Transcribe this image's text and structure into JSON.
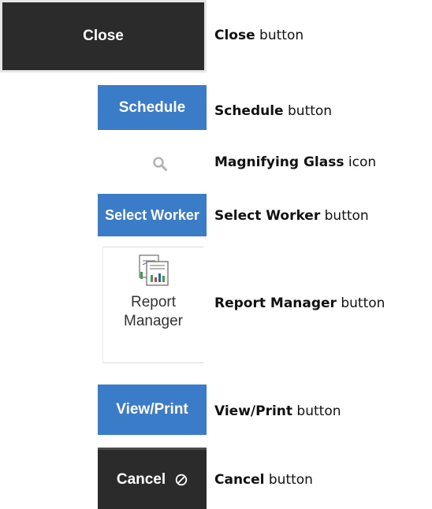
{
  "rows": [
    {
      "button_label": "Close",
      "desc_bold": "Close",
      "desc_rest": " button"
    },
    {
      "button_label": "Schedule",
      "desc_bold": "Schedule",
      "desc_rest": " button"
    },
    {
      "desc_bold": "Magnifying Glass",
      "desc_rest": " icon"
    },
    {
      "button_label": "Select Worker",
      "desc_bold": "Select Worker",
      "desc_rest": " button"
    },
    {
      "button_label_line1": "Report",
      "button_label_line2": "Manager",
      "desc_bold": "Report Manager",
      "desc_rest": " button"
    },
    {
      "button_label": "View/Print",
      "desc_bold": "View/Print",
      "desc_rest": " button"
    },
    {
      "button_label": "Cancel",
      "desc_bold": "Cancel",
      "desc_rest": " button"
    }
  ],
  "colors": {
    "dark": "#2b2b2b",
    "blue": "#3a7cc8",
    "icon_gray": "#b3b3b3"
  },
  "icons": [
    "search-icon",
    "report-chart-icon",
    "cancel-circle-slash-icon"
  ]
}
